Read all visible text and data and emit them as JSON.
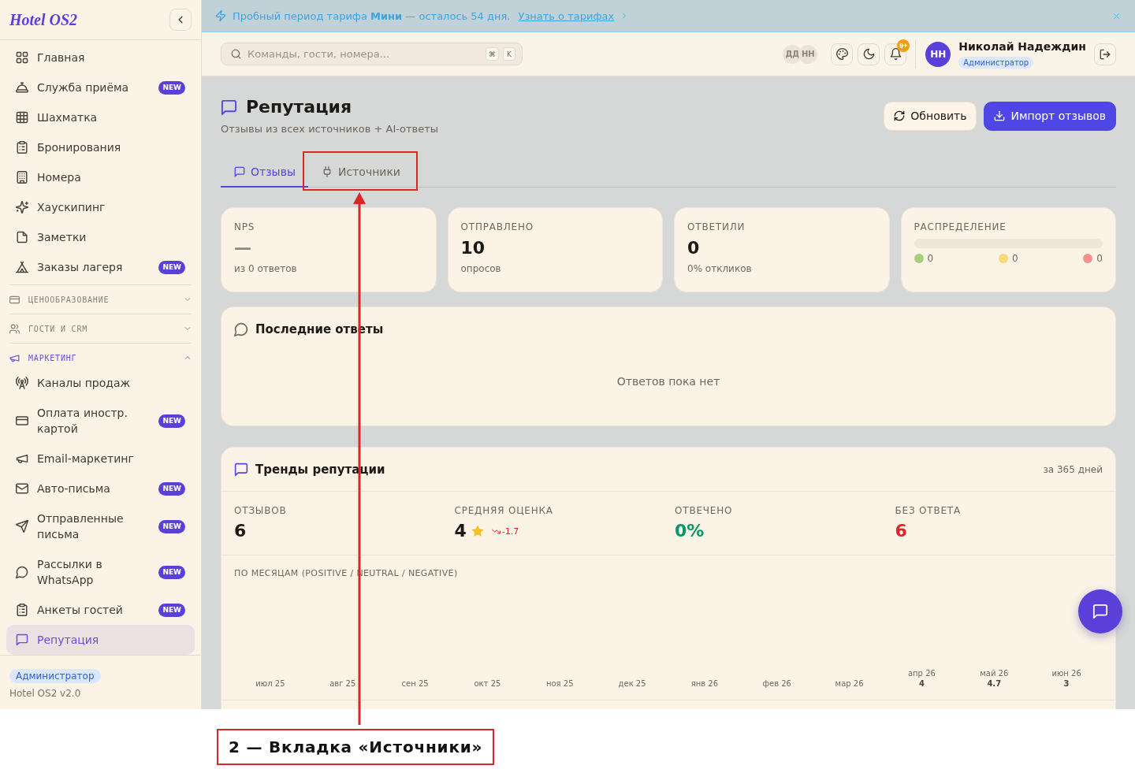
{
  "sidebar": {
    "logo": "Hotel OS2",
    "items": [
      {
        "label": "Главная",
        "selected": false
      },
      {
        "label": "Служба приёма",
        "badge": "NEW",
        "selected": false
      },
      {
        "label": "Шахматка",
        "selected": false
      },
      {
        "label": "Бронирования",
        "selected": false
      },
      {
        "label": "Номера",
        "selected": false
      },
      {
        "label": "Хаускипинг",
        "selected": false
      },
      {
        "label": "Заметки",
        "selected": false
      },
      {
        "label": "Заказы лагеря",
        "badge": "NEW",
        "selected": false
      }
    ],
    "sections": [
      {
        "label": "ЦЕНООБРАЗОВАНИЕ",
        "expanded": false
      },
      {
        "label": "ГОСТИ И CRM",
        "expanded": false
      },
      {
        "label": "МАРКЕТИНГ",
        "expanded": true,
        "children": [
          {
            "label": "Каналы продаж",
            "selected": false
          },
          {
            "label": "Оплата иностр. картой",
            "badge": "NEW",
            "selected": false
          },
          {
            "label": "Email-маркетинг",
            "selected": false
          },
          {
            "label": "Авто-письма",
            "badge": "NEW",
            "selected": false
          },
          {
            "label": "Отправленные письма",
            "badge": "NEW",
            "selected": false
          },
          {
            "label": "Рассылки в WhatsApp",
            "badge": "NEW",
            "selected": false
          },
          {
            "label": "Анкеты гостей",
            "badge": "NEW",
            "selected": false
          },
          {
            "label": "Репутация",
            "selected": true
          }
        ]
      }
    ],
    "role": "Администратор",
    "version": "Hotel OS2 v2.0"
  },
  "banner": {
    "text": "Пробный период тарифа **Мини** — осталось 54 дня.",
    "link": "Узнать о тарифах"
  },
  "topbar": {
    "search": {
      "placeholder": "Команды, гости, номера...",
      "keys": [
        "⌘",
        "K"
      ]
    },
    "presence": [
      "ДД",
      "НН"
    ],
    "notifications": "9+",
    "user": {
      "initials": "НН",
      "name": "Николай Надеждин",
      "role": "Администратор"
    }
  },
  "page": {
    "title": "Репутация",
    "subtitle": "Отзывы из всех источников + AI-ответы",
    "actions": [
      {
        "label": "Обновить",
        "kind": "secondary"
      },
      {
        "label": "Импорт отзывов",
        "kind": "primary"
      }
    ]
  },
  "tabs": [
    {
      "label": "Отзывы",
      "selected": true
    },
    {
      "label": "Источники",
      "selected": false
    }
  ],
  "stats": [
    {
      "kind": "value",
      "label": "NPS",
      "value": "—",
      "empty": true,
      "note": "из 0 ответов"
    },
    {
      "kind": "value",
      "label": "ОТПРАВЛЕНО",
      "value": "10",
      "empty": false,
      "note": "опросов"
    },
    {
      "kind": "value",
      "label": "ОТВЕТИЛИ",
      "value": "0",
      "empty": false,
      "note": "0% откликов"
    },
    {
      "kind": "distribution",
      "label": "РАСПРЕДЕЛЕНИЕ",
      "segments": [
        {
          "color": "#a6cf7d",
          "count": "0"
        },
        {
          "color": "#f8d87a",
          "count": "0"
        },
        {
          "color": "#f4928b",
          "count": "0"
        }
      ]
    }
  ],
  "recent": {
    "title": "Последние ответы",
    "empty_text": "Ответов пока нет"
  },
  "trends": {
    "title": "Тренды репутации",
    "period": "за 365 дней",
    "metrics": [
      {
        "kind": "number",
        "label": "ОТЗЫВОВ",
        "value": "6",
        "color": "#1c1917"
      },
      {
        "kind": "rating",
        "label": "СРЕДНЯЯ ОЦЕНКА",
        "value": "4",
        "color": "#1c1917",
        "change": "-1.7"
      },
      {
        "kind": "number",
        "label": "ОТВЕЧЕНО",
        "value": "0%",
        "color": "#059669"
      },
      {
        "kind": "number",
        "label": "БЕЗ ОТВЕТА",
        "value": "6",
        "color": "#dc2626"
      }
    ],
    "monthly": {
      "title": "ПО МЕСЯЦАМ (POSITIVE / NEUTRAL / NEGATIVE)",
      "months": [
        {
          "label": "июл 25"
        },
        {
          "label": "авг 25"
        },
        {
          "label": "сен 25"
        },
        {
          "label": "окт 25"
        },
        {
          "label": "ноя 25"
        },
        {
          "label": "дек 25"
        },
        {
          "label": "янв 26"
        },
        {
          "label": "фев 26"
        },
        {
          "label": "мар 26"
        },
        {
          "label": "апр 26",
          "rating": "4"
        },
        {
          "label": "май 26",
          "rating": "4.7"
        },
        {
          "label": "июн 26",
          "rating": "3"
        }
      ]
    }
  },
  "annotation": {
    "callout": "2 — Вкладка «Источники»"
  }
}
